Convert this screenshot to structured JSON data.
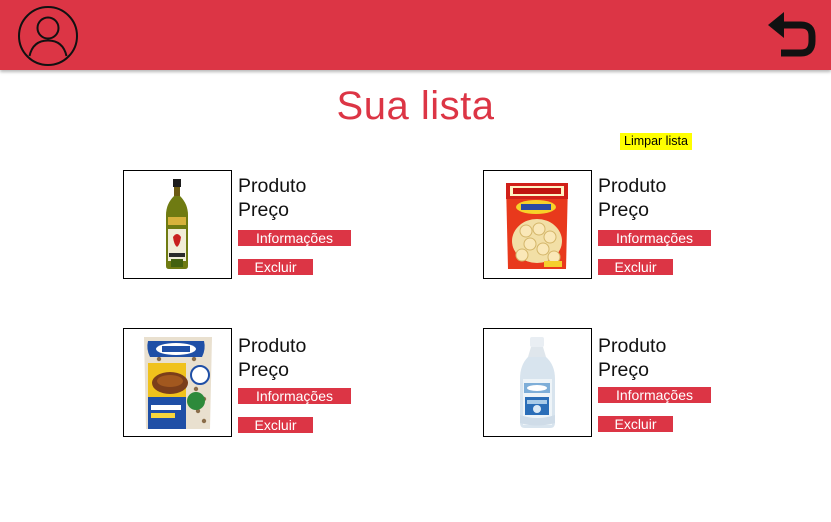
{
  "header": {
    "profile_icon": "user-circle-icon",
    "back_icon": "undo-arrow-icon",
    "bar_color": "#dc3545"
  },
  "page": {
    "title": "Sua lista",
    "clear_label": "Limpar lista"
  },
  "products": [
    {
      "name": "Produto",
      "price": "Preço",
      "info_label": "Informações",
      "delete_label": "Excluir",
      "image": "olive-oil-bottle"
    },
    {
      "name": "Produto",
      "price": "Preço",
      "info_label": "Informações",
      "delete_label": "Excluir",
      "image": "biscuit-bag"
    },
    {
      "name": "Produto",
      "price": "Preço",
      "info_label": "Informações",
      "delete_label": "Excluir",
      "image": "bean-bag"
    },
    {
      "name": "Produto",
      "price": "Preço",
      "info_label": "Informações",
      "delete_label": "Excluir",
      "image": "fabric-softener-bottle"
    }
  ],
  "colors": {
    "accent": "#dc3545",
    "clear_button": "#ffff00"
  }
}
